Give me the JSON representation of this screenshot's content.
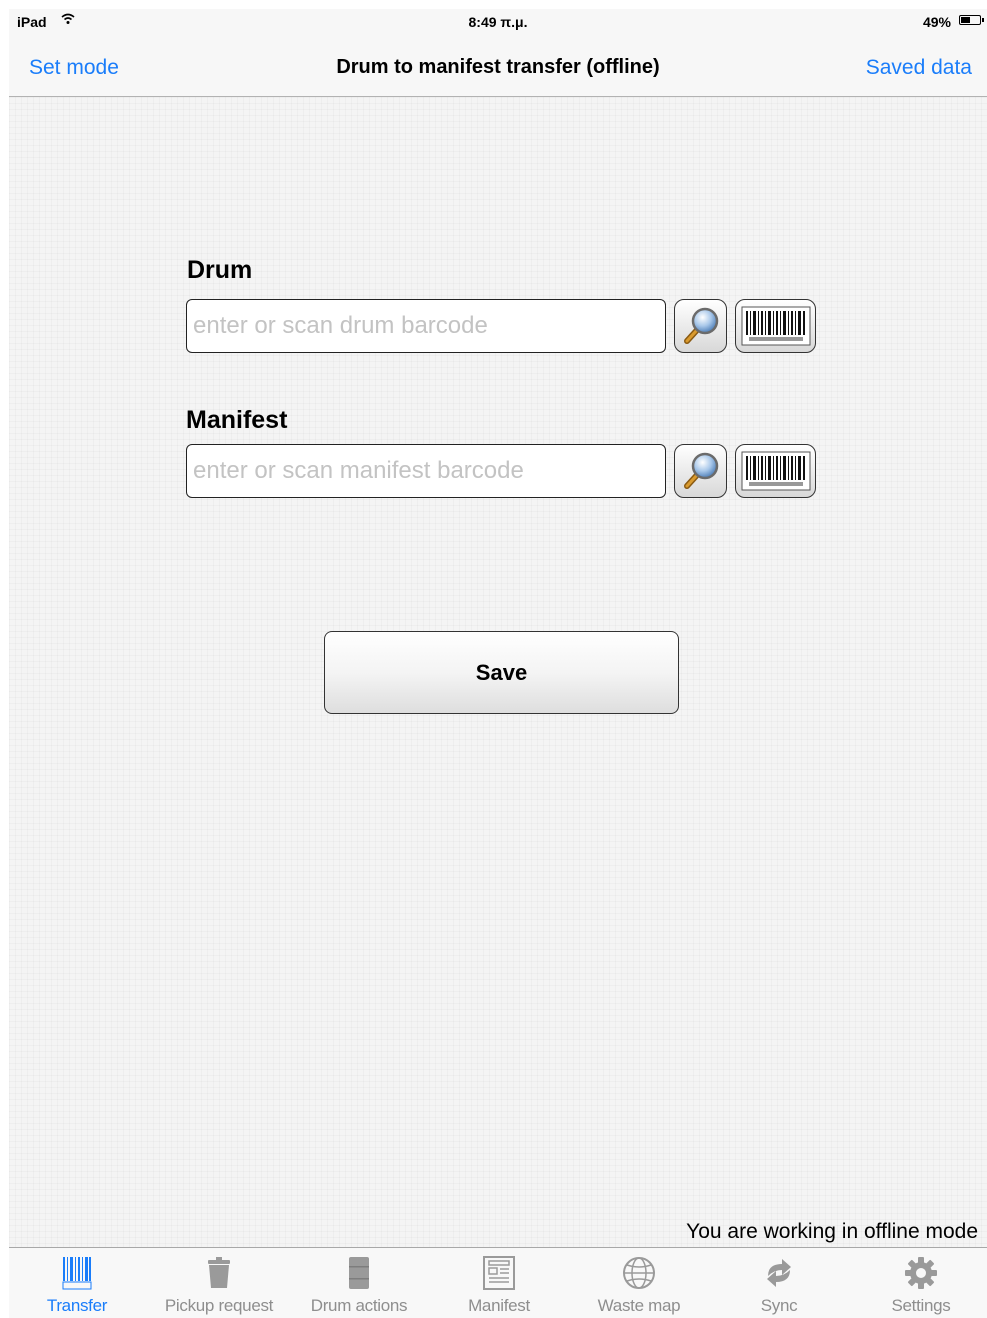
{
  "status_bar": {
    "device": "iPad",
    "time": "8:49 π.μ.",
    "battery_percent": "49%",
    "battery_level": 0.49
  },
  "nav": {
    "left_button": "Set mode",
    "title": "Drum to manifest transfer (offline)",
    "right_button": "Saved data"
  },
  "form": {
    "drum": {
      "label": "Drum",
      "value": "",
      "placeholder": "enter or scan drum barcode"
    },
    "manifest": {
      "label": "Manifest",
      "value": "",
      "placeholder": "enter or scan manifest barcode"
    },
    "save_label": "Save"
  },
  "status_message": "You are working in offline mode",
  "tabs": [
    {
      "label": "Transfer",
      "icon": "barcode-icon",
      "active": true
    },
    {
      "label": "Pickup request",
      "icon": "trash-can-icon",
      "active": false
    },
    {
      "label": "Drum actions",
      "icon": "drum-icon",
      "active": false
    },
    {
      "label": "Manifest",
      "icon": "document-icon",
      "active": false
    },
    {
      "label": "Waste map",
      "icon": "globe-icon",
      "active": false
    },
    {
      "label": "Sync",
      "icon": "sync-icon",
      "active": false
    },
    {
      "label": "Settings",
      "icon": "gear-icon",
      "active": false
    }
  ],
  "colors": {
    "accent": "#1a7dfa",
    "tab_inactive": "#8e8e8e"
  }
}
